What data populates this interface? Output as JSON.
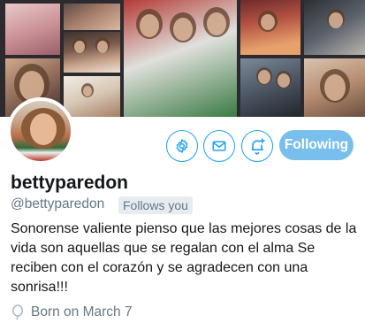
{
  "profile": {
    "display_name": "bettyparedon",
    "handle": "@bettyparedon",
    "follows_you": "Follows you",
    "bio": "Sonorense valiente pienso que las mejores cosas de la vida son aquellas que se regalan con el alma Se reciben con el corazón y se agradecen con una sonrisa!!!",
    "birthday": "Born on March 7"
  },
  "actions": {
    "settings_icon": "gear-icon",
    "message_icon": "envelope-icon",
    "notify_icon": "bell-plus-icon",
    "following_label": "Following"
  },
  "colors": {
    "accent": "#1da1f2",
    "following_bg": "#79bfee",
    "secondary_text": "#657786"
  }
}
